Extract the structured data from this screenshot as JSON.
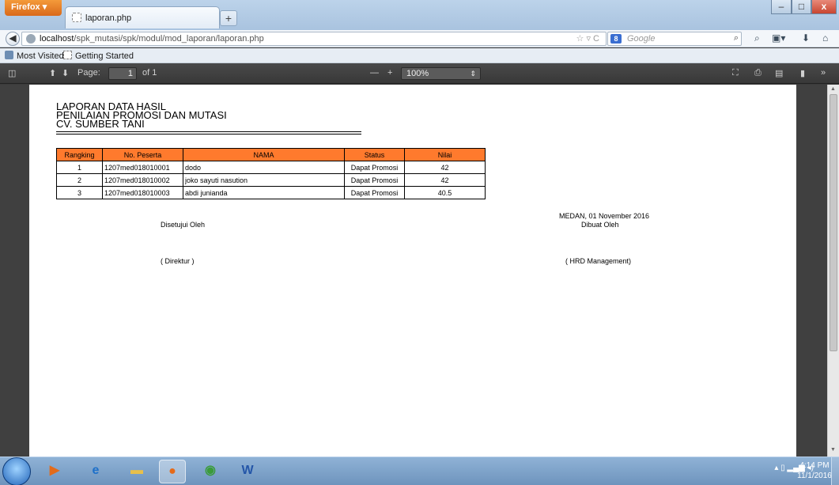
{
  "browser": {
    "menu_label": "Firefox",
    "tab_title": "laporan.php",
    "url_host": "localhost",
    "url_path": "/spk_mutasi/spk/modul/mod_laporan/laporan.php",
    "search_placeholder": "Google",
    "search_engine_badge": "8"
  },
  "bookmarks": {
    "most_visited": "Most Visited",
    "getting_started": "Getting Started"
  },
  "pdf_toolbar": {
    "page_label": "Page:",
    "page_current": "1",
    "page_of": "of 1",
    "zoom_value": "100%"
  },
  "report": {
    "title_line1": "LAPORAN DATA HASIL",
    "title_line2": "PENILAIAN PROMOSI DAN MUTASI",
    "title_line3": "CV. SUMBER TANI",
    "columns": [
      "Rangking",
      "No. Peserta",
      "NAMA",
      "Status",
      "Nilai"
    ],
    "rows": [
      {
        "rank": "1",
        "no": "1207med018010001",
        "nama": "dodo",
        "status": "Dapat Promosi",
        "nilai": "42"
      },
      {
        "rank": "2",
        "no": "1207med018010002",
        "nama": "joko sayuti nasution",
        "status": "Dapat Promosi",
        "nilai": "42"
      },
      {
        "rank": "3",
        "no": "1207med018010003",
        "nama": "abdi junianda",
        "status": "Dapat Promosi",
        "nilai": "40.5"
      }
    ],
    "left_sign_caption": "Disetujui Oleh",
    "left_sign_name": "( Direktur )",
    "date_place": "MEDAN, 01 November 2016",
    "right_sign_caption": "Dibuat Oleh",
    "right_sign_name": "( HRD Management)"
  },
  "taskbar": {
    "time": "4:14 PM",
    "date": "11/1/2016"
  },
  "colors": {
    "table_header": "#ff7a2d",
    "firefox_button": "#e47a22"
  }
}
